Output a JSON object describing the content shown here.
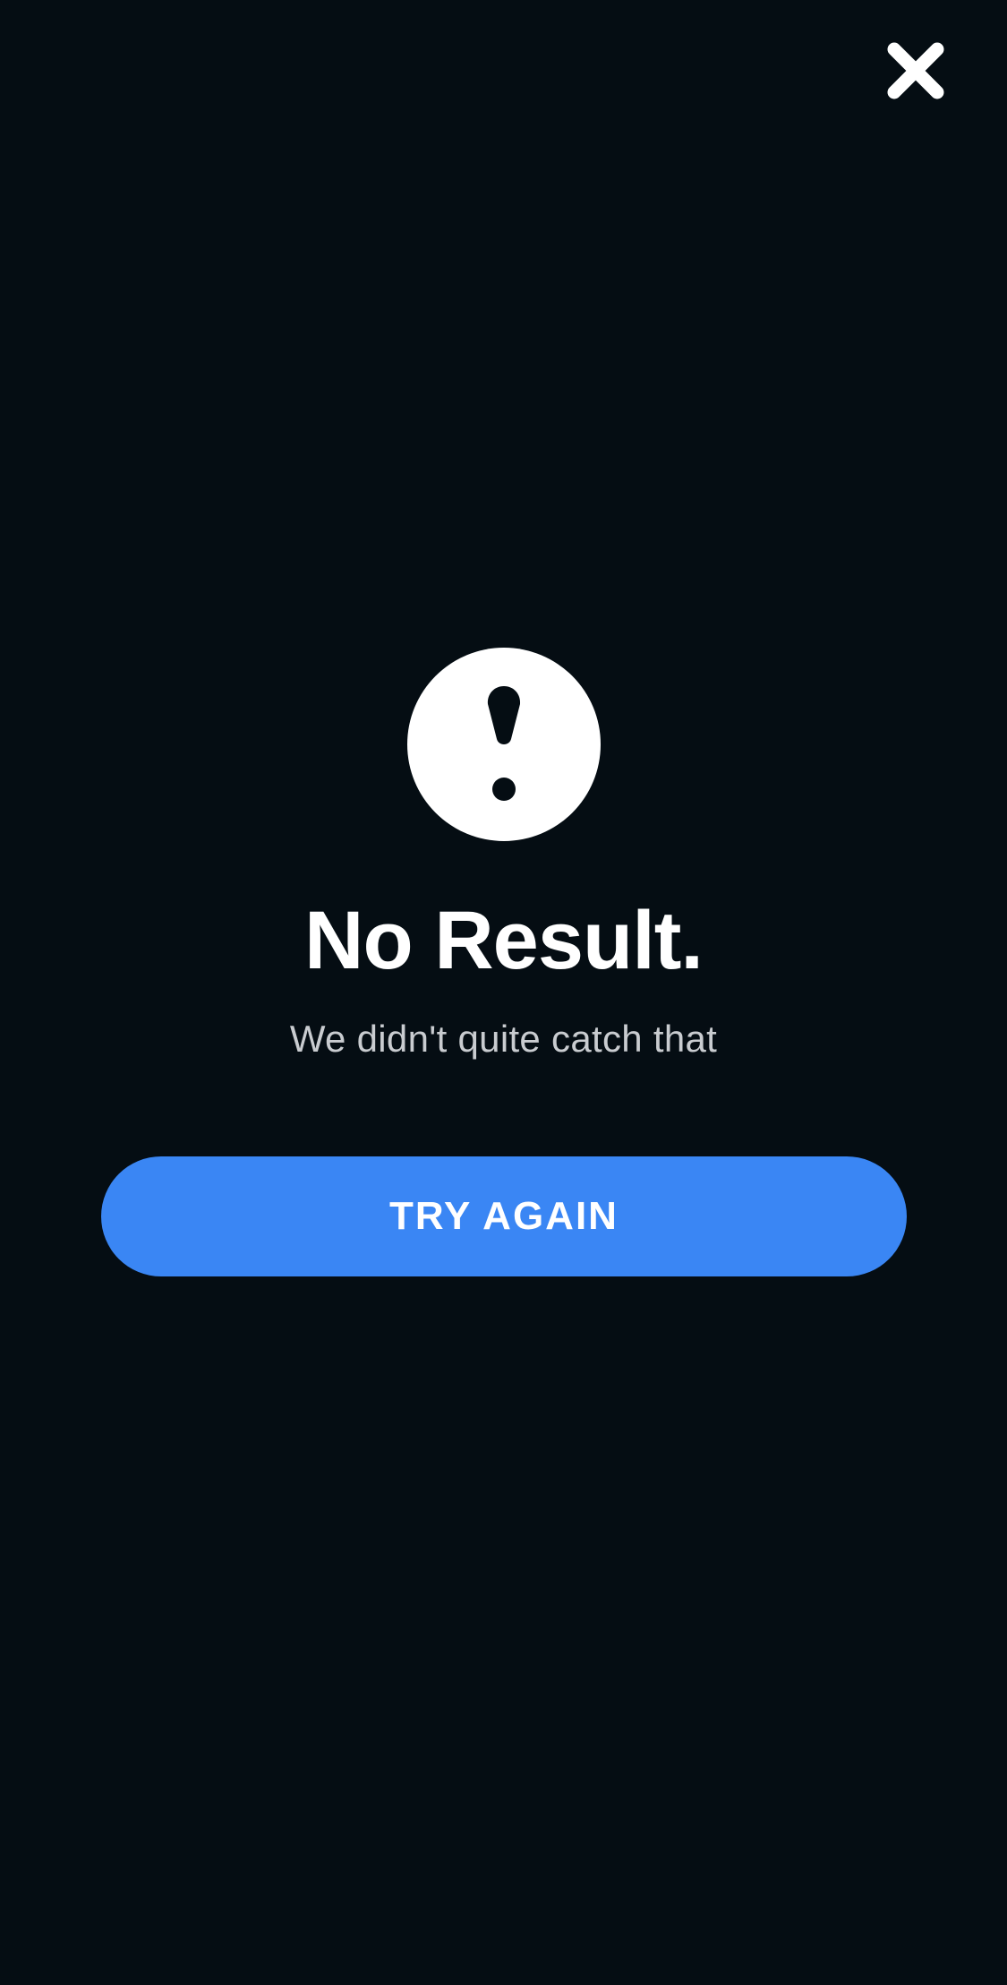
{
  "header": {
    "close_icon": "close-icon"
  },
  "result": {
    "icon": "exclamation-circle-icon",
    "title": "No Result.",
    "subtitle": "We didn't quite catch that"
  },
  "actions": {
    "try_again_label": "TRY AGAIN"
  },
  "colors": {
    "background": "#050d13",
    "accent": "#3a86f4",
    "title_text": "#ffffff",
    "subtitle_text": "#c9ccd0"
  }
}
